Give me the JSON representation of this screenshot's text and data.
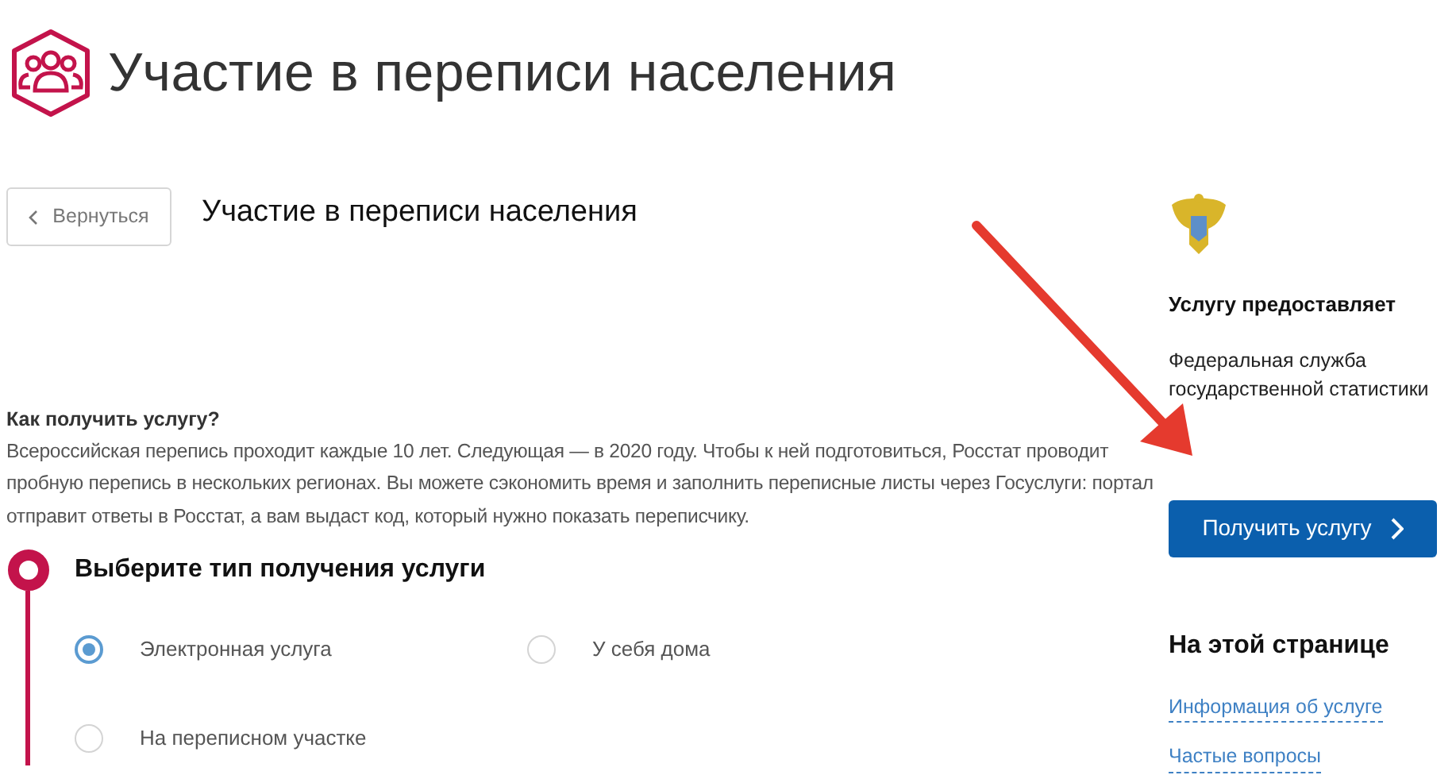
{
  "header": {
    "title": "Участие в переписи населения"
  },
  "back_button": {
    "label": "Вернуться"
  },
  "service_title": "Участие в переписи населения",
  "how_to": {
    "heading": "Как получить услугу?",
    "text": "Всероссийская перепись проходит каждые 10 лет. Следующая — в 2020 году. Чтобы к ней подготовиться, Росстат проводит пробную перепись в нескольких регионах. Вы можете сэкономить время и заполнить переписные листы через Госуслуги: портал отправит ответы в Росстат, а вам выдаст код, который нужно показать переписчику."
  },
  "step": {
    "heading": "Выберите тип получения услуги",
    "options": [
      {
        "label": "Электронная услуга",
        "selected": true
      },
      {
        "label": "У себя дома",
        "selected": false
      },
      {
        "label": "На переписном участке",
        "selected": false
      }
    ]
  },
  "provider": {
    "heading": "Услугу предоставляет",
    "name": "Федеральная служба государственной статистики"
  },
  "get_button": {
    "label": "Получить услугу"
  },
  "on_page": {
    "heading": "На этой странице",
    "links": [
      "Информация об услуге",
      "Частые вопросы"
    ]
  }
}
